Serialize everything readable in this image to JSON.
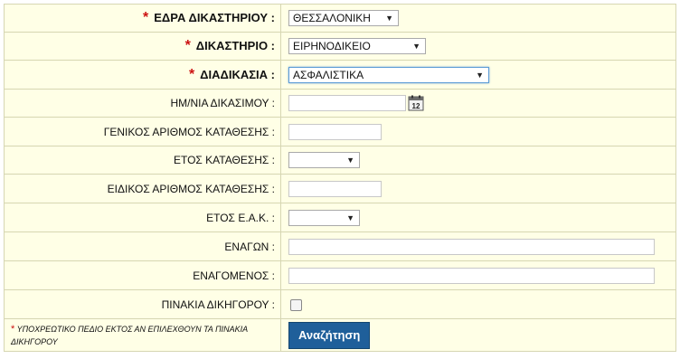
{
  "form": {
    "seat": {
      "label": "ΕΔΡΑ ΔΙΚΑΣΤΗΡΙΟΥ :",
      "value": "ΘΕΣΣΑΛΟΝΙΚΗ"
    },
    "court": {
      "label": "ΔΙΚΑΣΤΗΡΙΟ :",
      "value": "ΕΙΡΗΝΟΔΙΚΕΙΟ"
    },
    "procedure": {
      "label": "ΔΙΑΔΙΚΑΣΙΑ :",
      "value": "ΑΣΦΑΛΙΣΤΙΚΑ"
    },
    "hearing_date": {
      "label": "ΗΜ/ΝΙΑ ΔΙΚΑΣΙΜΟΥ :",
      "value": "",
      "calendar_day": "12"
    },
    "general_filing_no": {
      "label": "ΓΕΝΙΚΟΣ ΑΡΙΘΜΟΣ ΚΑΤΑΘΕΣΗΣ :",
      "value": ""
    },
    "filing_year": {
      "label": "ΕΤΟΣ ΚΑΤΑΘΕΣΗΣ :",
      "value": ""
    },
    "special_filing_no": {
      "label": "ΕΙΔΙΚΟΣ ΑΡΙΘΜΟΣ ΚΑΤΑΘΕΣΗΣ :",
      "value": ""
    },
    "eak_year": {
      "label": "ΕΤΟΣ Ε.Α.Κ. :",
      "value": ""
    },
    "plaintiff": {
      "label": "ΕΝΑΓΩΝ :",
      "value": ""
    },
    "defendant": {
      "label": "ΕΝΑΓΟΜΕΝΟΣ :",
      "value": ""
    },
    "lawyer_lists": {
      "label": "ΠΙΝΑΚΙΑ ΔΙΚΗΓΟΡΟΥ :",
      "checked": false
    },
    "note": "ΥΠΟΧΡΕΩΤΙΚΟ ΠΕΔΙΟ ΕΚΤΟΣ ΑΝ ΕΠΙΛΕΧΘΟΥΝ ΤΑ ΠΙΝΑΚΙΑ ΔΙΚΗΓΟΡΟΥ",
    "required_mark": "*",
    "search_button": "Αναζήτηση"
  },
  "colors": {
    "row_bg": "#ffffe6",
    "required": "#cc1111",
    "button_bg": "#1f5f9a"
  }
}
